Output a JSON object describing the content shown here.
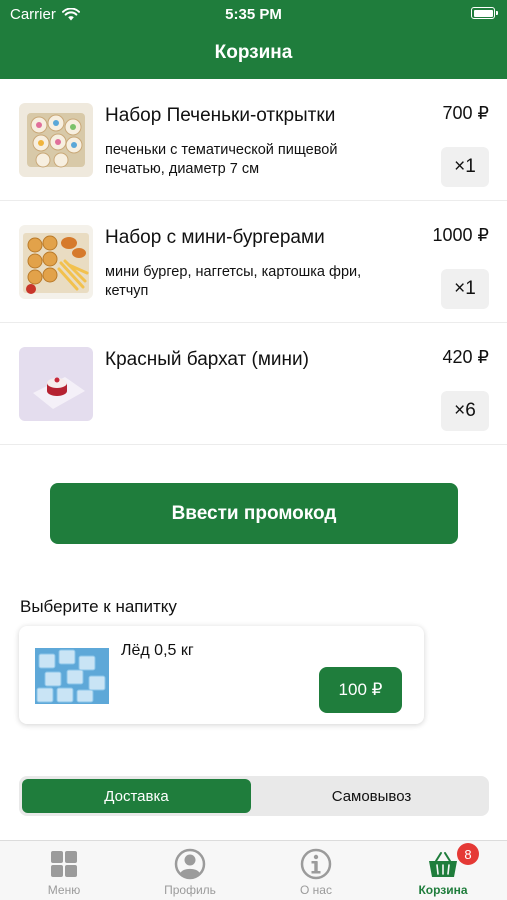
{
  "status_bar": {
    "carrier": "Carrier",
    "time": "5:35 PM"
  },
  "header": {
    "title": "Корзина"
  },
  "cart": {
    "items": [
      {
        "name": "Набор Печеньки-открытки",
        "description": "печеньки с тематической пищевой печатью, диаметр 7 см",
        "price": "700 ₽",
        "quantity": "×1"
      },
      {
        "name": "Набор с мини-бургерами",
        "description": "мини бургер, наггетсы, картошка фри, кетчуп",
        "price": "1000 ₽",
        "quantity": "×1"
      },
      {
        "name": "Красный бархат (мини)",
        "description": "",
        "price": "420 ₽",
        "quantity": "×6"
      }
    ]
  },
  "promo_button": {
    "label": "Ввести промокод"
  },
  "drinks": {
    "title": "Выберите к напитку",
    "item": {
      "name": "Лёд 0,5 кг",
      "price": "100 ₽"
    }
  },
  "delivery_toggle": {
    "options": [
      "Доставка",
      "Самовывоз"
    ],
    "selected": "Доставка"
  },
  "tab_bar": {
    "tabs": [
      {
        "label": "Меню",
        "icon": "grid-icon"
      },
      {
        "label": "Профиль",
        "icon": "profile-icon"
      },
      {
        "label": "О нас",
        "icon": "info-icon"
      },
      {
        "label": "Корзина",
        "icon": "basket-icon",
        "badge": "8"
      }
    ],
    "active": "Корзина"
  },
  "colors": {
    "brand_green": "#1f7d3c",
    "badge_red": "#e53935",
    "inactive_gray": "#9b9b9b"
  }
}
